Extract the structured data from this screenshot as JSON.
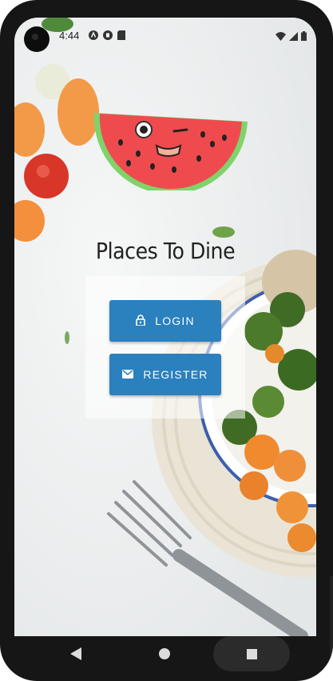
{
  "status_bar": {
    "time": "4:44",
    "icons_left": [
      "android-icon",
      "play-icon",
      "sd-card-icon"
    ],
    "icons_right": [
      "wifi-icon",
      "signal-icon",
      "battery-icon"
    ]
  },
  "app": {
    "title": "Places To Dine"
  },
  "buttons": {
    "login": {
      "label": "LOGIN",
      "icon": "lock-icon"
    },
    "register": {
      "label": "REGISTER",
      "icon": "mail-icon"
    }
  },
  "nav_bar": {
    "icons": [
      "back-icon",
      "home-icon",
      "recents-icon"
    ]
  },
  "colors": {
    "button": "#2b80be",
    "watermelon_red": "#ef4b4f",
    "watermelon_rind": "#7fd36a"
  }
}
